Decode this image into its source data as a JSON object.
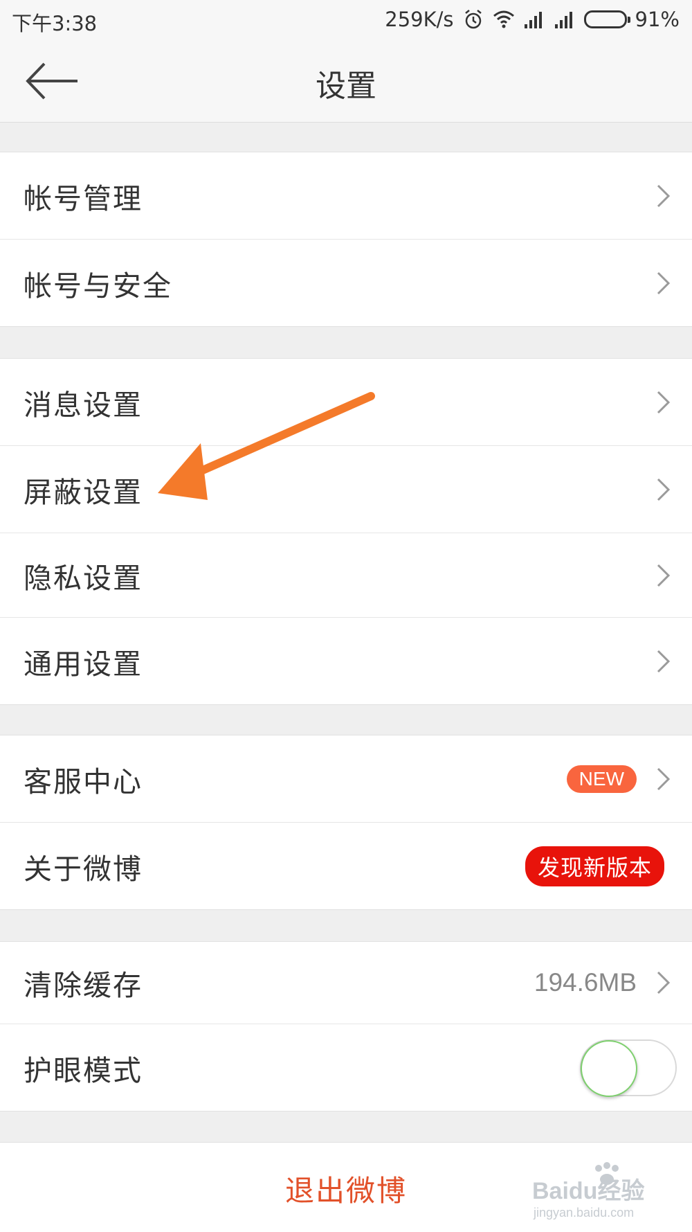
{
  "status_bar": {
    "time": "下午3:38",
    "network_speed": "259K/s",
    "battery_percent": "91%",
    "battery_level": 0.91,
    "icons": [
      "alarm-icon",
      "wifi-icon",
      "signal-icon",
      "signal-icon"
    ]
  },
  "header": {
    "title": "设置",
    "back_icon": "back-arrow-icon"
  },
  "groups": {
    "account": {
      "items": [
        {
          "label": "帐号管理"
        },
        {
          "label": "帐号与安全"
        }
      ]
    },
    "settings": {
      "items": [
        {
          "label": "消息设置"
        },
        {
          "label": "屏蔽设置"
        },
        {
          "label": "隐私设置"
        },
        {
          "label": "通用设置"
        }
      ]
    },
    "about": {
      "items": [
        {
          "label": "客服中心",
          "badge": "NEW"
        },
        {
          "label": "关于微博",
          "badge": "发现新版本"
        }
      ]
    },
    "storage": {
      "items": [
        {
          "label": "清除缓存",
          "value": "194.6MB"
        },
        {
          "label": "护眼模式",
          "toggle_on": false
        }
      ]
    }
  },
  "footer": {
    "logout_label": "退出微博"
  },
  "watermark": {
    "brand": "Baidu经验",
    "url": "jingyan.baidu.com"
  },
  "colors": {
    "accent_red": "#e2512a",
    "badge_new": "#f9653e",
    "badge_update": "#e8130b",
    "annotation_arrow": "#f47a2a",
    "battery_fill": "#f29d13"
  }
}
